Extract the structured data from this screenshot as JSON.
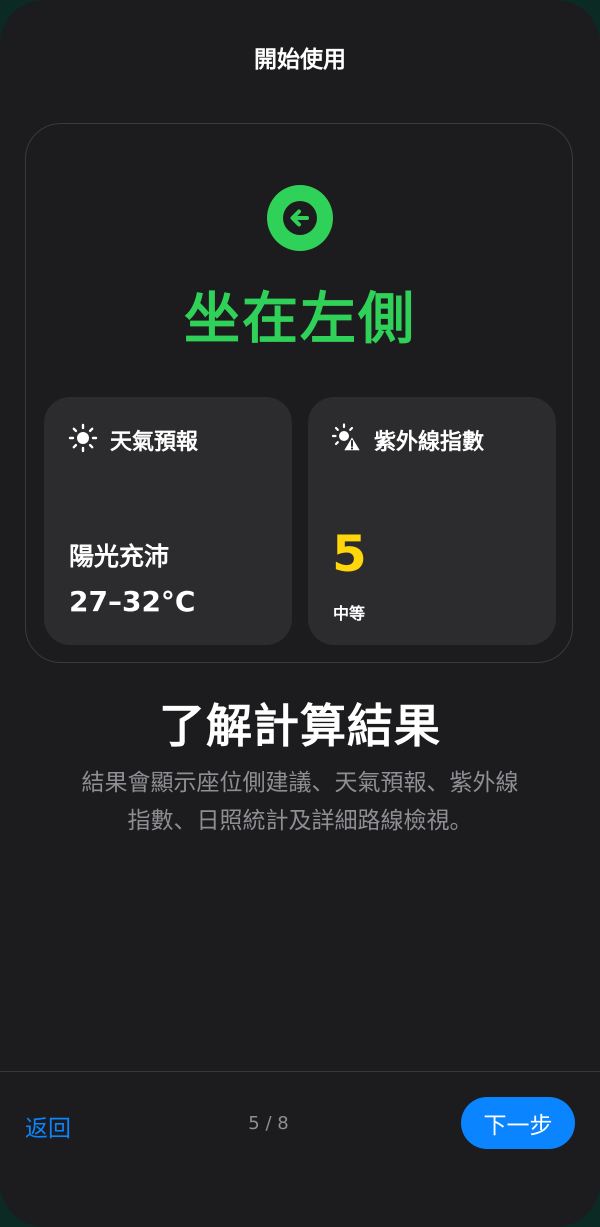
{
  "header": {
    "title": "開始使用"
  },
  "preview": {
    "arrow_icon": "arrow-left-circle-icon",
    "side_title": "坐在左側",
    "accent_color": "#30d158",
    "weather": {
      "icon": "sun-icon",
      "label": "天氣預報",
      "condition": "陽光充沛",
      "temperature": "27–32°C"
    },
    "uv": {
      "icon": "sun-warning-icon",
      "label": "紫外線指數",
      "value": "5",
      "level": "中等",
      "value_color": "#ffd60a"
    }
  },
  "step": {
    "title": "了解計算結果",
    "description_line1": "結果會顯示座位側建議、天氣預報、紫外線",
    "description_line2": "指數、日照統計及詳細路線檢視。"
  },
  "footer": {
    "back_label": "返回",
    "page_indicator": "5 / 8",
    "next_label": "下一步",
    "button_color": "#0a84ff"
  }
}
